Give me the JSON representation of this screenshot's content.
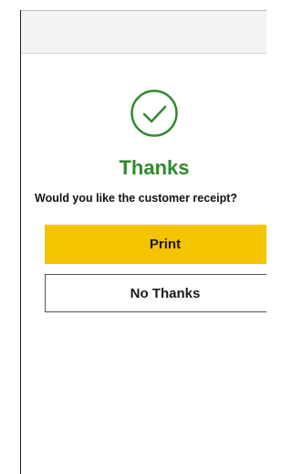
{
  "receipt_prompt": {
    "title": "Thanks",
    "question": "Would you like the customer receipt?",
    "icon": "check-circle-icon",
    "buttons": {
      "print_label": "Print",
      "no_thanks_label": "No Thanks"
    }
  },
  "colors": {
    "accent_green": "#2f8a2d",
    "print_button": "#f5c400"
  }
}
